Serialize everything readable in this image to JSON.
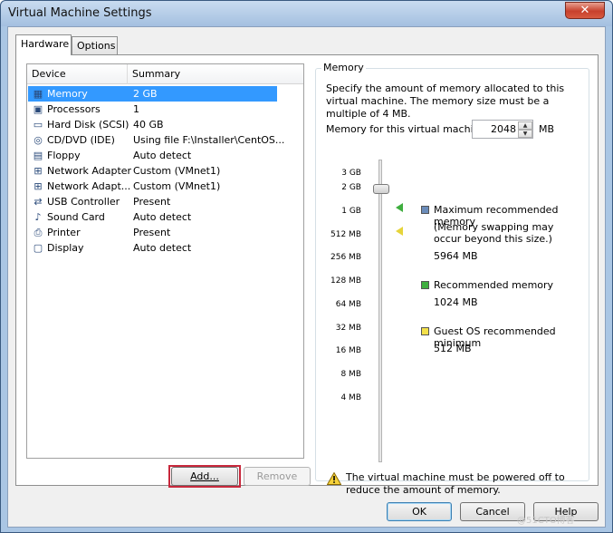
{
  "window": {
    "title": "Virtual Machine Settings",
    "close_glyph": "✕"
  },
  "tabs": [
    {
      "label": "Hardware"
    },
    {
      "label": "Options"
    }
  ],
  "device_list": {
    "headers": {
      "device": "Device",
      "summary": "Summary"
    },
    "items": [
      {
        "name": "Memory",
        "summary": "2 GB",
        "icon": "memory-icon",
        "glyph": "▦"
      },
      {
        "name": "Processors",
        "summary": "1",
        "icon": "processor-icon",
        "glyph": "▣"
      },
      {
        "name": "Hard Disk (SCSI)",
        "summary": "40 GB",
        "icon": "hard-disk-icon",
        "glyph": "▭"
      },
      {
        "name": "CD/DVD (IDE)",
        "summary": "Using file F:\\Installer\\CentOS...",
        "icon": "cd-dvd-icon",
        "glyph": "◎"
      },
      {
        "name": "Floppy",
        "summary": "Auto detect",
        "icon": "floppy-icon",
        "glyph": "▤"
      },
      {
        "name": "Network Adapter",
        "summary": "Custom (VMnet1)",
        "icon": "network-adapter-icon",
        "glyph": "⊞"
      },
      {
        "name": "Network Adapt...",
        "summary": "Custom (VMnet1)",
        "icon": "network-adapter-icon",
        "glyph": "⊞"
      },
      {
        "name": "USB Controller",
        "summary": "Present",
        "icon": "usb-icon",
        "glyph": "⇄"
      },
      {
        "name": "Sound Card",
        "summary": "Auto detect",
        "icon": "sound-card-icon",
        "glyph": "♪"
      },
      {
        "name": "Printer",
        "summary": "Present",
        "icon": "printer-icon",
        "glyph": "⎙"
      },
      {
        "name": "Display",
        "summary": "Auto detect",
        "icon": "display-icon",
        "glyph": "▢"
      }
    ],
    "selected_index": 0
  },
  "list_buttons": {
    "add": "Add...",
    "remove": "Remove"
  },
  "memory": {
    "group_title": "Memory",
    "description": "Specify the amount of memory allocated to this virtual machine. The memory size must be a multiple of 4 MB.",
    "field_label": "Memory for this virtual machine:",
    "value": "2048",
    "unit": "MB",
    "scale_ticks": [
      "3 GB",
      "2 GB",
      "1 GB",
      "512 MB",
      "256 MB",
      "128 MB",
      "64 MB",
      "32 MB",
      "16 MB",
      "8 MB",
      "4 MB"
    ],
    "legend": {
      "max": {
        "label": "Maximum recommended memory",
        "note": "(Memory swapping may occur beyond this size.)",
        "value": "5964 MB",
        "color": "#6b8cba"
      },
      "recommended": {
        "label": "Recommended memory",
        "value": "1024 MB",
        "color": "#3fae3f"
      },
      "guest_min": {
        "label": "Guest OS recommended minimum",
        "value": "512 MB",
        "color": "#f3e04a"
      }
    },
    "warning": "The virtual machine must be powered off to reduce the amount of memory."
  },
  "dialog_buttons": {
    "ok": "OK",
    "cancel": "Cancel",
    "help": "Help"
  },
  "watermark": "@51CTO博客"
}
